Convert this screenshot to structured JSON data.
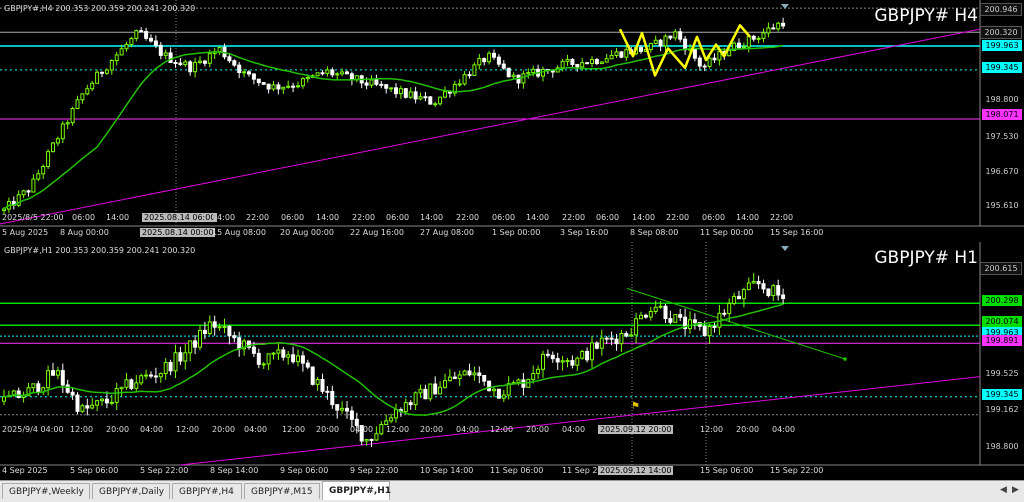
{
  "colors": {
    "background": "#000000",
    "up": "#7cfc00",
    "down": "#ffffff",
    "ma": "#22c000",
    "trendline": "#e000e0",
    "drawing": "#ffff00",
    "level_cyan": "#00ffff",
    "level_magenta": "#ff33ff",
    "level_green": "#00dd00"
  },
  "h4": {
    "header": "GBPJPY#,H4  200.353 200.359 200.241 200.320",
    "big_title": "GBPJPY# H4",
    "y_labels": [
      {
        "text": "200.946",
        "style": "plain"
      },
      {
        "text": "200.320",
        "style": "plain"
      },
      {
        "text": "199.963",
        "style": "cyan"
      },
      {
        "text": "199.345",
        "style": "cyan"
      },
      {
        "text": "198.800",
        "style": "plain"
      },
      {
        "text": "198.071",
        "style": "magenta"
      },
      {
        "text": "197.530",
        "style": "plain"
      },
      {
        "text": "196.670",
        "style": "plain"
      },
      {
        "text": "195.610",
        "style": "plain"
      }
    ],
    "inner_time_labels": [
      "2025/8/5 22:00",
      "06:00",
      "14:00",
      "2025.08.14 06:00",
      "14:00",
      "22:00",
      "06:00",
      "14:00",
      "22:00",
      "06:00",
      "14:00",
      "22:00",
      "06:00",
      "14:00",
      "22:00",
      "06:00",
      "14:00",
      "22:00",
      "06:00",
      "14:00",
      "22:00"
    ],
    "time_labels": [
      "5 Aug 2025",
      "8 Aug 00:00",
      "2025.08.14 00:00",
      "15 Aug 08:00",
      "20 Aug 00:00",
      "22 Aug 16:00",
      "27 Aug 08:00",
      "1 Sep 00:00",
      "3 Sep 16:00",
      "8 Sep 08:00",
      "11 Sep 00:00",
      "15 Sep 16:00"
    ]
  },
  "h1": {
    "header": "GBPJPY#,H1  200.353 200.359 200.241 200.320",
    "big_title": "GBPJPY# H1",
    "y_labels": [
      {
        "text": "200.615",
        "style": "plain"
      },
      {
        "text": "200.298",
        "style": "green"
      },
      {
        "text": "200.074",
        "style": "green"
      },
      {
        "text": "199.963",
        "style": "cyan"
      },
      {
        "text": "199.891",
        "style": "magenta"
      },
      {
        "text": "199.525",
        "style": "plain"
      },
      {
        "text": "199.345",
        "style": "cyan"
      },
      {
        "text": "199.162",
        "style": "plain"
      },
      {
        "text": "198.800",
        "style": "plain"
      }
    ],
    "inner_time_labels": [
      "2025/9/4 04:00",
      "12:00",
      "20:00",
      "04:00",
      "12:00",
      "20:00",
      "04:00",
      "12:00",
      "20:00",
      "04:00",
      "12:00",
      "20:00",
      "04:00",
      "12:00",
      "20:00",
      "04:00",
      "2025.09.12 20:00",
      "12:00",
      "20:00",
      "04:00"
    ],
    "time_labels": [
      "4 Sep 2025",
      "5 Sep 06:00",
      "5 Sep 22:00",
      "8 Sep 14:00",
      "9 Sep 06:00",
      "9 Sep 22:00",
      "10 Sep 14:00",
      "11 Sep 06:00",
      "11 Sep 22:00",
      "2025.09.12 14:00",
      "15 Sep 06:00",
      "15 Sep 22:00"
    ]
  },
  "tabs": [
    {
      "label": "GBPJPY#,Weekly",
      "active": false
    },
    {
      "label": "GBPJPY#,Daily",
      "active": false
    },
    {
      "label": "GBPJPY#,H4",
      "active": false
    },
    {
      "label": "GBPJPY#,M15",
      "active": false
    },
    {
      "label": "GBPJPY#,H1",
      "active": true
    }
  ]
}
